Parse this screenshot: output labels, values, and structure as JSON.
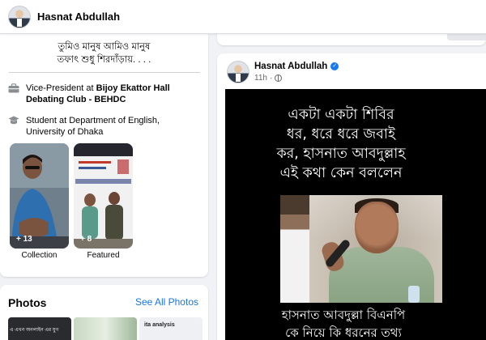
{
  "profile": {
    "name": "Hasnat Abdullah"
  },
  "intro": {
    "bio": "তুমিও মানুষ আমিও মানুষ\nতফাৎ শুধু শিরদাঁড়ায়. . . .",
    "work_prefix": "Vice-President at ",
    "work_org": "Bijoy Ekattor Hall Debating Club - BEHDC",
    "education_prefix": "Student at ",
    "education_org": "Department of English, University of Dhaka",
    "work_icon": "briefcase-icon",
    "education_icon": "graduation-cap-icon"
  },
  "highlights": [
    {
      "count": "+ 13",
      "label": "Collection"
    },
    {
      "count": "+ 8",
      "label": "Featured"
    }
  ],
  "photos": {
    "title": "Photos",
    "see_all": "See All Photos",
    "thumb_texts": [
      "এ এখন অনলাইন এর যুগ",
      "",
      "ita analysis"
    ]
  },
  "post": {
    "author": "Hasnat Abdullah",
    "time": "11h",
    "privacy_icon": "globe-icon",
    "verified_icon": "verified-badge-icon",
    "headline": "একটা একটা শিবির\nধর, ধরে ধরে জবাই\nকর,  হাসনাত আবদুল্লাহ\nএই কথা কেন বললেন",
    "caption": "হাসনাত আবদুল্লা বিএনপি\nকে নিয়ে কি ধরনের তথ্য"
  },
  "colors": {
    "link": "#1b74e4",
    "verified": "#1877f2",
    "background": "#f0f2f5"
  }
}
